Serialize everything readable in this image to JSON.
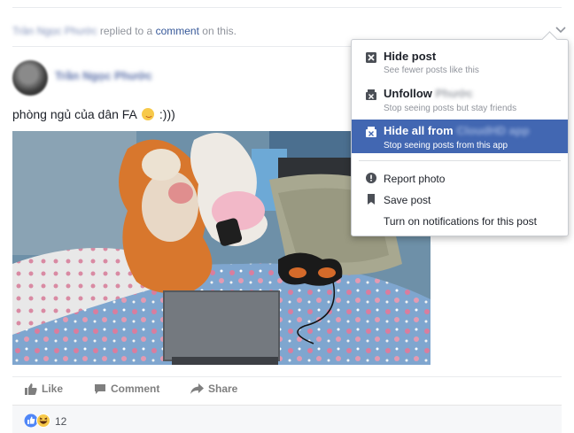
{
  "story": {
    "actor": "Trần Ngọc Phước",
    "replied_text": "replied to a",
    "comment_link": "comment",
    "on_this": "on this."
  },
  "post": {
    "author": "Trần Ngọc Phước",
    "text_before_emoji": "phòng ngủ của dân FA",
    "text_after_emoji": " :)))"
  },
  "actions": {
    "like": "Like",
    "comment": "Comment",
    "share": "Share"
  },
  "reactions": {
    "count": "12",
    "types": [
      "like-icon",
      "haha-icon"
    ]
  },
  "menu": {
    "hide_post": {
      "label": "Hide post",
      "sub": "See fewer posts like this"
    },
    "unfollow": {
      "label": "Unfollow",
      "name": "Phước",
      "sub": "Stop seeing posts but stay friends"
    },
    "hide_all": {
      "label": "Hide all from",
      "name": "CloudHD app",
      "sub": "Stop seeing posts from this app"
    },
    "report_photo": "Report photo",
    "save_post": "Save post",
    "notifications": "Turn on notifications for this post"
  },
  "colors": {
    "accent": "#4267b2",
    "link": "#365899"
  }
}
